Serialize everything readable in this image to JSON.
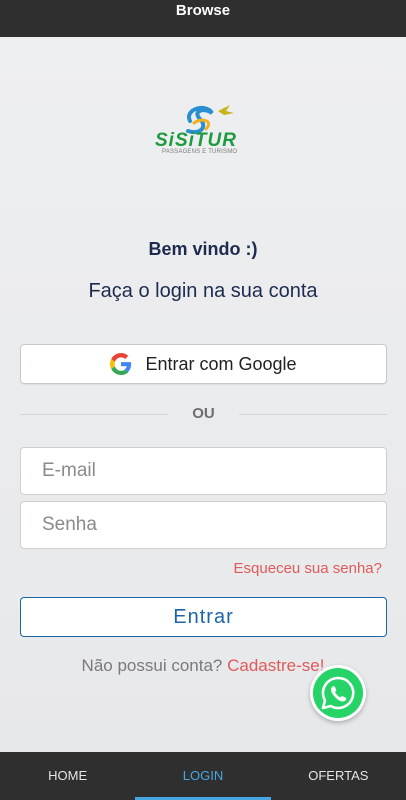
{
  "header": {
    "title": "Browse"
  },
  "brand": {
    "name": "SiSiTUR",
    "subtitle": "PASSAGENS E TURISMO"
  },
  "login": {
    "welcome": "Bem vindo :)",
    "title": "Faça o login na sua conta",
    "google_button": "Entrar com Google",
    "divider": "OU",
    "email_placeholder": "E-mail",
    "password_placeholder": "Senha",
    "forgot": "Esqueceu sua senha?",
    "submit": "Entrar",
    "no_account": "Não possui conta?",
    "signup_link": "Cadastre-se!"
  },
  "nav": {
    "items": [
      {
        "label": "HOME"
      },
      {
        "label": "LOGIN",
        "active": true
      },
      {
        "label": "OFERTAS"
      }
    ]
  },
  "icons": {
    "google": "google-g-icon",
    "whatsapp": "whatsapp-icon"
  },
  "colors": {
    "accent": "#46a7e2",
    "link": "#e05a5a",
    "primary": "#1a66a6",
    "heading": "#1d2b4f",
    "whatsapp": "#25d366",
    "bar": "#2f2f2f"
  }
}
